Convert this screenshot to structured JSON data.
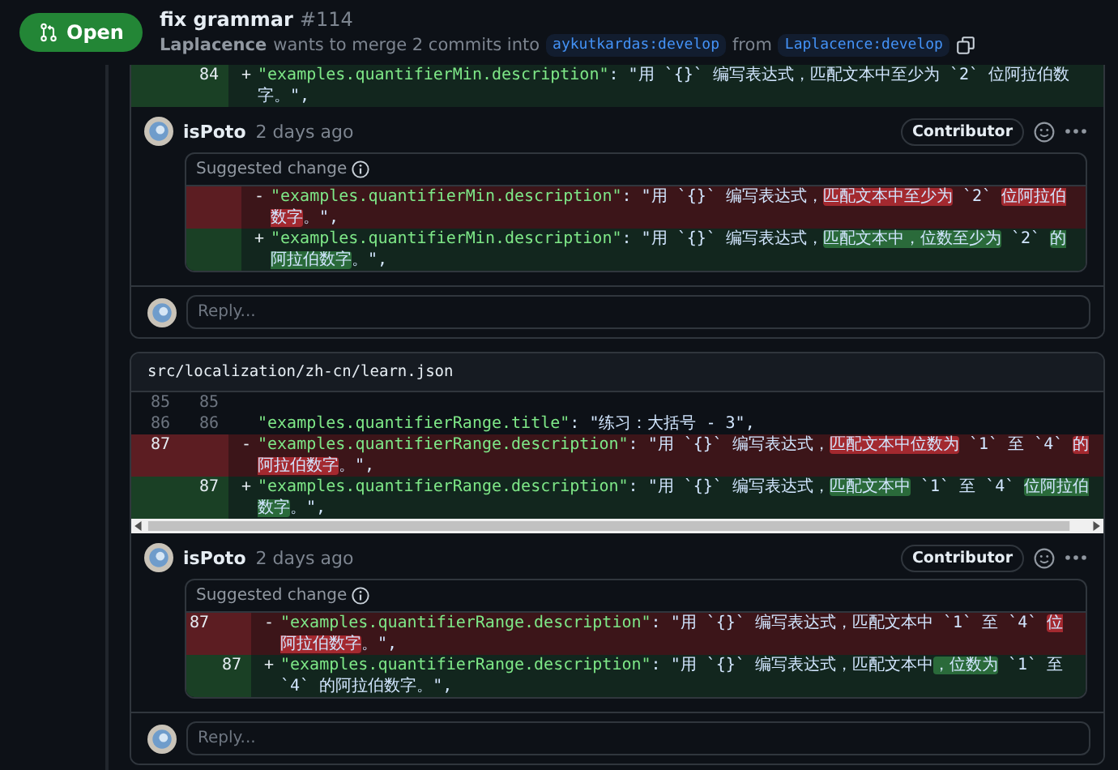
{
  "header": {
    "state": {
      "label": "Open"
    },
    "title": "fix grammar",
    "number": "#114",
    "author": "Laplacence",
    "merge_text": "wants to merge 2 commits into",
    "base_branch": "aykutkardas:develop",
    "from_text": "from",
    "head_branch": "Laplacence:develop"
  },
  "top_lines": [
    {
      "kind": "add",
      "new": "84",
      "sign": "+",
      "key": "\"examples.quantifierMin.description\"",
      "segments": [
        {
          "text": ": \"用 `{}` 编写表达式，匹配文本中至少为 `2` 位阿拉伯数字。\",",
          "changed": false
        }
      ]
    }
  ],
  "threads": [
    {
      "comment": {
        "author": "isPoto",
        "time": "2 days ago",
        "badge": "Contributor",
        "suggestion_label": "Suggested change",
        "lines": [
          {
            "kind": "del",
            "sign": "-",
            "key": "\"examples.quantifierMin.description\"",
            "segments": [
              {
                "text": ": \"用 `{}` 编写表达式，",
                "changed": false
              },
              {
                "text": "匹配文本中至少为",
                "changed": true
              },
              {
                "text": " `2` ",
                "changed": false
              },
              {
                "text": "位阿拉伯数字",
                "changed": true
              },
              {
                "text": "。\",",
                "changed": false
              }
            ]
          },
          {
            "kind": "add",
            "sign": "+",
            "key": "\"examples.quantifierMin.description\"",
            "segments": [
              {
                "text": ": \"用 `{}` 编写表达式，",
                "changed": false
              },
              {
                "text": "匹配文本中，位数至少为",
                "changed": true
              },
              {
                "text": " `2` ",
                "changed": false
              },
              {
                "text": "的阿拉伯数字",
                "changed": true
              },
              {
                "text": "。\",",
                "changed": false
              }
            ]
          }
        ]
      },
      "reply_placeholder": "Reply..."
    },
    {
      "file": "src/localization/zh-cn/learn.json",
      "diff_lines": [
        {
          "kind": "context",
          "old": "85",
          "new": "85"
        },
        {
          "kind": "context",
          "old": "86",
          "new": "86",
          "key": "\"examples.quantifierRange.title\"",
          "text": ": \"练习：大括号 - 3\","
        },
        {
          "kind": "del",
          "old": "87",
          "sign": "-",
          "key": "\"examples.quantifierRange.description\"",
          "segments": [
            {
              "text": ": \"用 `{}` 编写表达式，",
              "changed": false
            },
            {
              "text": "匹配文本中位数为",
              "changed": true
            },
            {
              "text": " `1` 至 `4` ",
              "changed": false
            },
            {
              "text": "的阿拉伯数字",
              "changed": true
            },
            {
              "text": "。\",",
              "changed": false
            }
          ]
        },
        {
          "kind": "add",
          "new": "87",
          "sign": "+",
          "key": "\"examples.quantifierRange.description\"",
          "segments": [
            {
              "text": ": \"用 `{}` 编写表达式，",
              "changed": false
            },
            {
              "text": "匹配文本中",
              "changed": true
            },
            {
              "text": " `1` 至 `4` ",
              "changed": false
            },
            {
              "text": "位阿拉伯数字",
              "changed": true
            },
            {
              "text": "。\",",
              "changed": false
            }
          ]
        }
      ],
      "comment": {
        "author": "isPoto",
        "time": "2 days ago",
        "badge": "Contributor",
        "suggestion_label": "Suggested change",
        "lines": [
          {
            "kind": "del",
            "old": "87",
            "sign": "-",
            "key": "\"examples.quantifierRange.description\"",
            "segments": [
              {
                "text": ": \"用 `{}` 编写表达式，匹配文本中 `1` 至 `4` ",
                "changed": false
              },
              {
                "text": "位阿拉伯数字",
                "changed": true
              },
              {
                "text": "。\",",
                "changed": false
              }
            ]
          },
          {
            "kind": "add",
            "new": "87",
            "sign": "+",
            "key": "\"examples.quantifierRange.description\"",
            "segments": [
              {
                "text": ": \"用 `{}` 编写表达式，匹配文本中",
                "changed": false
              },
              {
                "text": "，位数为",
                "changed": true
              },
              {
                "text": " `1` 至 `4` 的阿拉伯数字。\",",
                "changed": false
              }
            ]
          }
        ]
      },
      "reply_placeholder": "Reply..."
    }
  ]
}
